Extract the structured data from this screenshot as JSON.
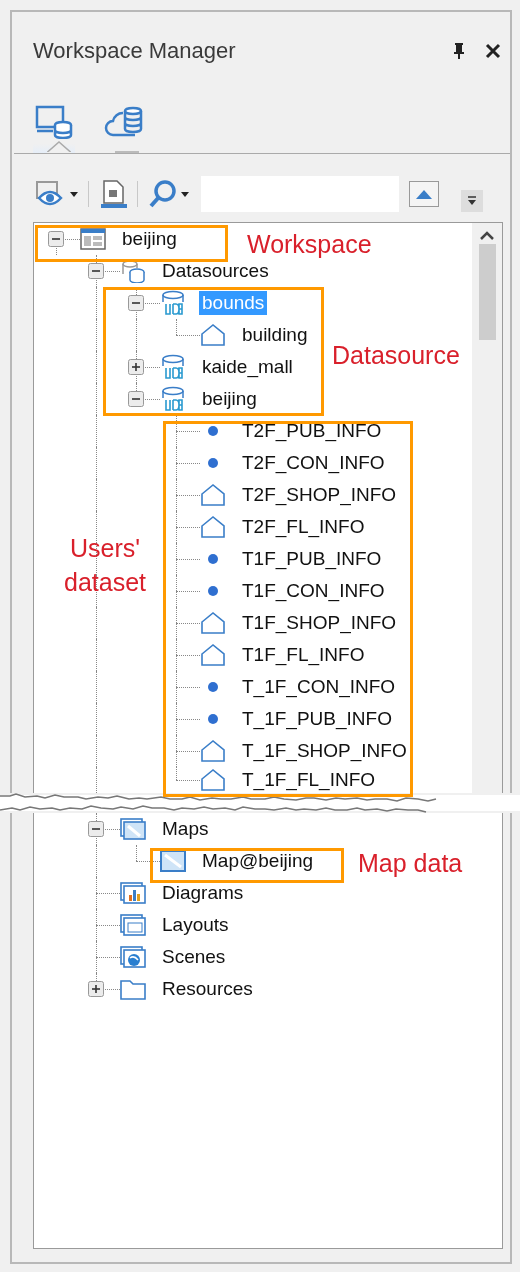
{
  "panel": {
    "title": "Workspace Manager"
  },
  "tabs": [
    {
      "kind": "local",
      "selected": true
    },
    {
      "kind": "cloud",
      "selected": false
    }
  ],
  "tree": [
    {
      "label": "beijing",
      "kind": "workspace",
      "expanded": true,
      "selected": false,
      "children": [
        {
          "label": "Datasources",
          "kind": "datasources",
          "expanded": true,
          "selected": false,
          "children": [
            {
              "label": "bounds",
              "kind": "datasource",
              "expanded": true,
              "selected": true,
              "children": [
                {
                  "label": "building",
                  "kind": "region",
                  "selected": false
                }
              ]
            },
            {
              "label": "kaide_mall",
              "kind": "datasource",
              "expanded": false,
              "selected": false
            },
            {
              "label": "beijing",
              "kind": "datasource",
              "expanded": true,
              "selected": false,
              "children": [
                {
                  "label": "T2F_PUB_INFO",
                  "kind": "point",
                  "selected": false
                },
                {
                  "label": "T2F_CON_INFO",
                  "kind": "point",
                  "selected": false
                },
                {
                  "label": "T2F_SHOP_INFO",
                  "kind": "region",
                  "selected": false
                },
                {
                  "label": "T2F_FL_INFO",
                  "kind": "region",
                  "selected": false
                },
                {
                  "label": "T1F_PUB_INFO",
                  "kind": "point",
                  "selected": false
                },
                {
                  "label": "T1F_CON_INFO",
                  "kind": "point",
                  "selected": false
                },
                {
                  "label": "T1F_SHOP_INFO",
                  "kind": "region",
                  "selected": false
                },
                {
                  "label": "T1F_FL_INFO",
                  "kind": "region",
                  "selected": false
                },
                {
                  "label": "T_1F_CON_INFO",
                  "kind": "point",
                  "selected": false
                },
                {
                  "label": "T_1F_PUB_INFO",
                  "kind": "point",
                  "selected": false
                },
                {
                  "label": "T_1F_SHOP_INFO",
                  "kind": "region",
                  "selected": false
                },
                {
                  "label": "T_1F_FL_INFO",
                  "kind": "region",
                  "selected": false
                }
              ]
            }
          ]
        },
        {
          "label": "Maps",
          "kind": "maps",
          "expanded": true,
          "selected": false,
          "break_before": true,
          "children": [
            {
              "label": "Map@beijing",
              "kind": "map",
              "selected": false
            }
          ]
        },
        {
          "label": "Diagrams",
          "kind": "diagrams",
          "selected": false
        },
        {
          "label": "Layouts",
          "kind": "layouts",
          "selected": false
        },
        {
          "label": "Scenes",
          "kind": "scenes",
          "selected": false
        },
        {
          "label": "Resources",
          "kind": "resources",
          "expanded": false,
          "selected": false
        }
      ]
    }
  ],
  "annotations": [
    {
      "label": "Workspace"
    },
    {
      "label": "Users' dataset"
    },
    {
      "label": "Datasource"
    },
    {
      "label": "Map data"
    }
  ]
}
